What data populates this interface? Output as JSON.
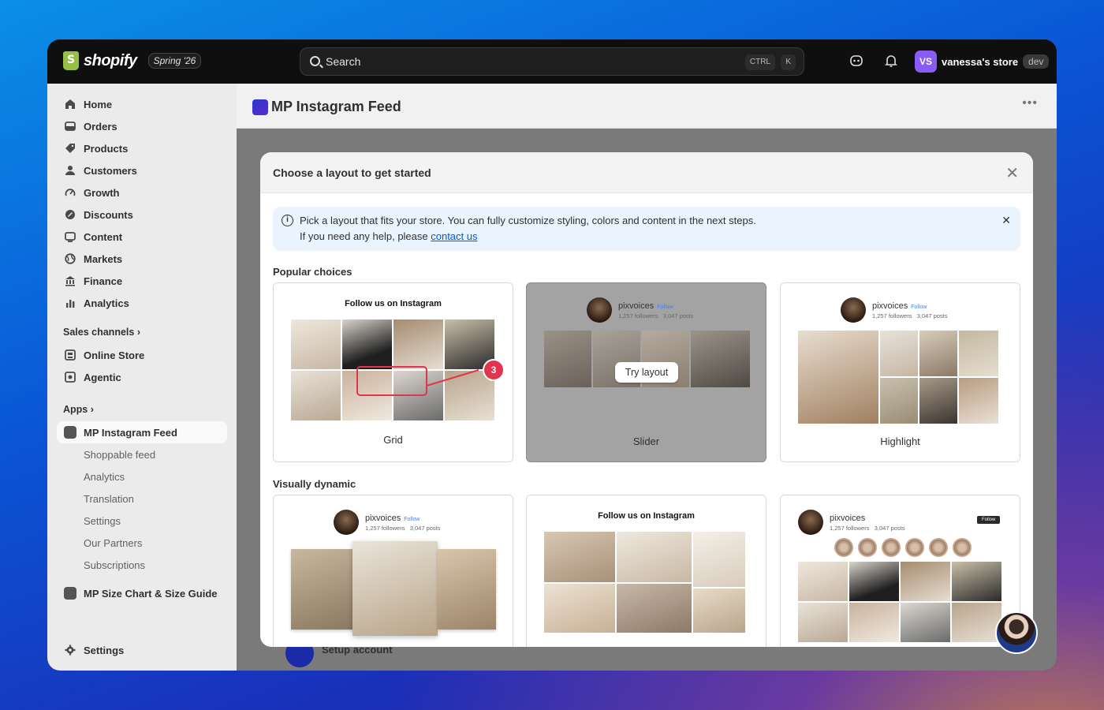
{
  "topbar": {
    "logo_text": "shopify",
    "logo_badge": "Spring '26",
    "search_placeholder": "Search",
    "kbd_ctrl": "CTRL",
    "kbd_k": "K",
    "avatar_initials": "VS",
    "store_name": "vanessa's store",
    "store_badge": "dev"
  },
  "sidebar": {
    "items": [
      {
        "label": "Home",
        "icon": "home-icon"
      },
      {
        "label": "Orders",
        "icon": "orders-icon"
      },
      {
        "label": "Products",
        "icon": "tag-icon"
      },
      {
        "label": "Customers",
        "icon": "person-icon"
      },
      {
        "label": "Growth",
        "icon": "gauge-icon"
      },
      {
        "label": "Discounts",
        "icon": "discount-icon"
      },
      {
        "label": "Content",
        "icon": "content-icon"
      },
      {
        "label": "Markets",
        "icon": "globe-icon"
      },
      {
        "label": "Finance",
        "icon": "bank-icon"
      },
      {
        "label": "Analytics",
        "icon": "bar-chart-icon"
      }
    ],
    "sales_channels_label": "Sales channels",
    "channels": [
      {
        "label": "Online Store",
        "icon": "store-icon"
      },
      {
        "label": "Agentic",
        "icon": "agentic-icon"
      }
    ],
    "apps_label": "Apps",
    "active_app": "MP Instagram Feed",
    "subitems": [
      "Shoppable feed",
      "Analytics",
      "Translation",
      "Settings",
      "Our Partners",
      "Subscriptions"
    ],
    "other_app": "MP Size Chart & Size Guide",
    "settings_label": "Settings"
  },
  "main": {
    "title": "MP Instagram Feed",
    "behind_setup": "Setup account"
  },
  "modal": {
    "title": "Choose a layout to get started",
    "banner_line1": "Pick a layout that fits your store. You can fully customize styling, colors and content in the next steps.",
    "banner_line2_prefix": "If you need any help, please ",
    "banner_link": "contact us",
    "popular_label": "Popular choices",
    "dynamic_label": "Visually dynamic",
    "follow_heading": "Follow us on Instagram",
    "profile_name": "pixvoices",
    "profile_follow": "Follow",
    "profile_followers": "1,257 followers",
    "profile_posts": "3,047 posts",
    "follow_button": "Follow",
    "try_layout": "Try layout",
    "step_number": "3",
    "cards": [
      {
        "caption": "Grid"
      },
      {
        "caption": "Slider"
      },
      {
        "caption": "Highlight"
      }
    ]
  }
}
